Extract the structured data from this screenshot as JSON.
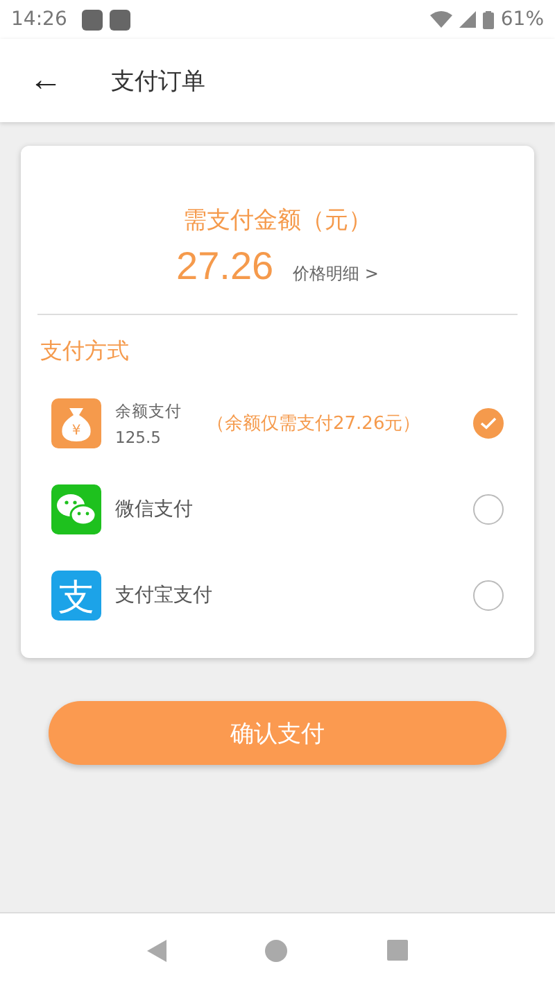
{
  "status_bar": {
    "time": "14:26",
    "battery": "61%"
  },
  "header": {
    "back": "←",
    "title": "支付订单"
  },
  "amount": {
    "label": "需支付金额（元）",
    "value": "27.26",
    "detail_link": "价格明细 >"
  },
  "payment": {
    "title": "支付方式",
    "methods": [
      {
        "kind": "balance",
        "icon_glyph": "¥",
        "name": "余额支付",
        "balance": "125.5",
        "note": "（余额仅需支付27.26元）",
        "selected": true
      },
      {
        "kind": "wechat",
        "name": "微信支付",
        "selected": false
      },
      {
        "kind": "alipay",
        "icon_glyph": "支",
        "name": "支付宝支付",
        "selected": false
      }
    ]
  },
  "confirm_button": "确认支付"
}
